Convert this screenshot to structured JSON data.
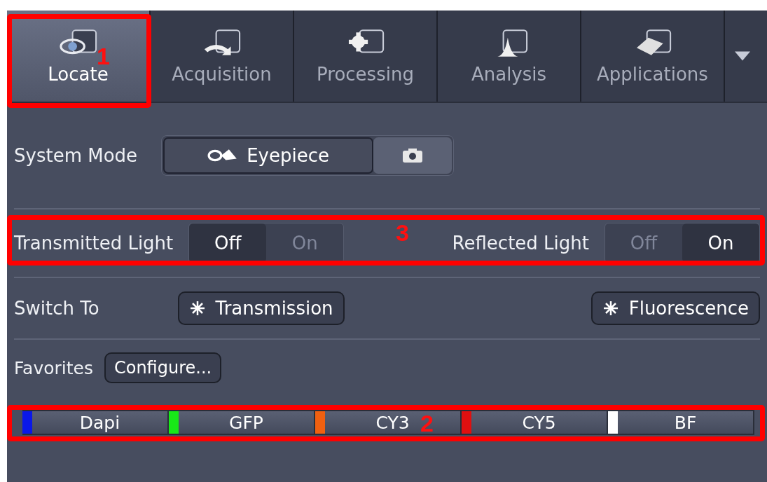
{
  "tabs": [
    {
      "label": "Locate",
      "selected": true
    },
    {
      "label": "Acquisition",
      "selected": false
    },
    {
      "label": "Processing",
      "selected": false
    },
    {
      "label": "Analysis",
      "selected": false
    },
    {
      "label": "Applications",
      "selected": false
    }
  ],
  "system_mode": {
    "label": "System Mode",
    "options": [
      {
        "kind": "eyepiece",
        "label": "Eyepiece",
        "selected": true
      },
      {
        "kind": "camera",
        "selected": false
      }
    ]
  },
  "lights": [
    {
      "label": "Transmitted Light",
      "options": [
        {
          "label": "Off",
          "selected": true
        },
        {
          "label": "On",
          "selected": false
        }
      ]
    },
    {
      "label": "Reflected Light",
      "options": [
        {
          "label": "Off",
          "selected": false
        },
        {
          "label": "On",
          "selected": true
        }
      ]
    }
  ],
  "switch_to": {
    "label": "Switch To",
    "buttons": [
      "Transmission",
      "Fluorescence"
    ]
  },
  "favorites": {
    "label": "Favorites",
    "button": "Configure...",
    "channels": [
      {
        "label": "Dapi",
        "color": "#0a18e8"
      },
      {
        "label": "GFP",
        "color": "#18e818"
      },
      {
        "label": "CY3",
        "color": "#f06010"
      },
      {
        "label": "CY5",
        "color": "#e01010"
      },
      {
        "label": "BF",
        "color": "#ffffff"
      }
    ]
  },
  "annotations": [
    "1",
    "2",
    "3"
  ]
}
